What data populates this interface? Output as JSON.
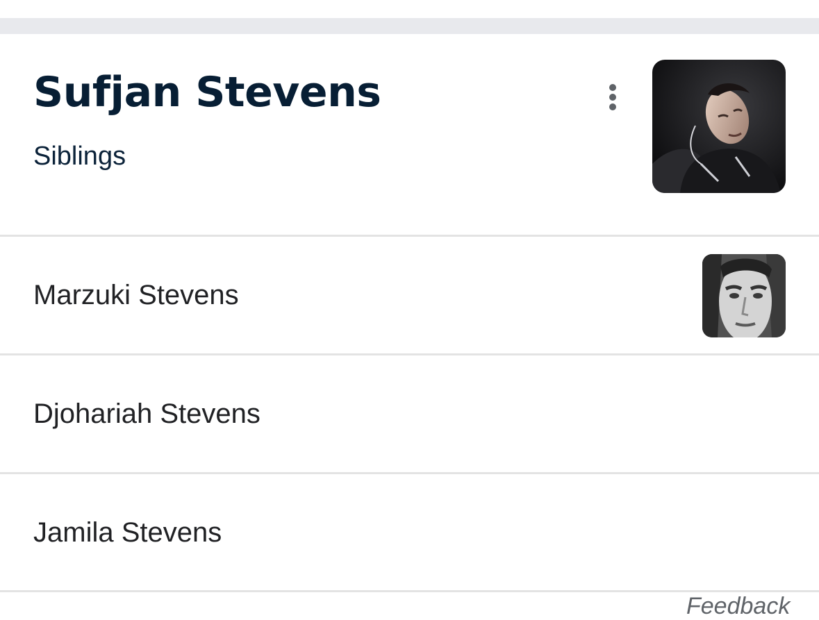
{
  "header": {
    "title": "Sufjan Stevens",
    "subtitle": "Siblings",
    "more_icon": "more-vert-icon",
    "thumbnail": "sufjan-stevens-photo"
  },
  "siblings": [
    {
      "name": "Marzuki Stevens",
      "thumbnail": "marzuki-stevens-photo"
    },
    {
      "name": "Djohariah Stevens"
    },
    {
      "name": "Jamila Stevens"
    }
  ],
  "footer": {
    "feedback_label": "Feedback"
  },
  "colors": {
    "title": "#071e34",
    "subtitle": "#0b2239",
    "row_text": "#202124",
    "divider": "#e3e3e3",
    "top_band": "#e8e9ed",
    "icon": "#5f6368"
  }
}
